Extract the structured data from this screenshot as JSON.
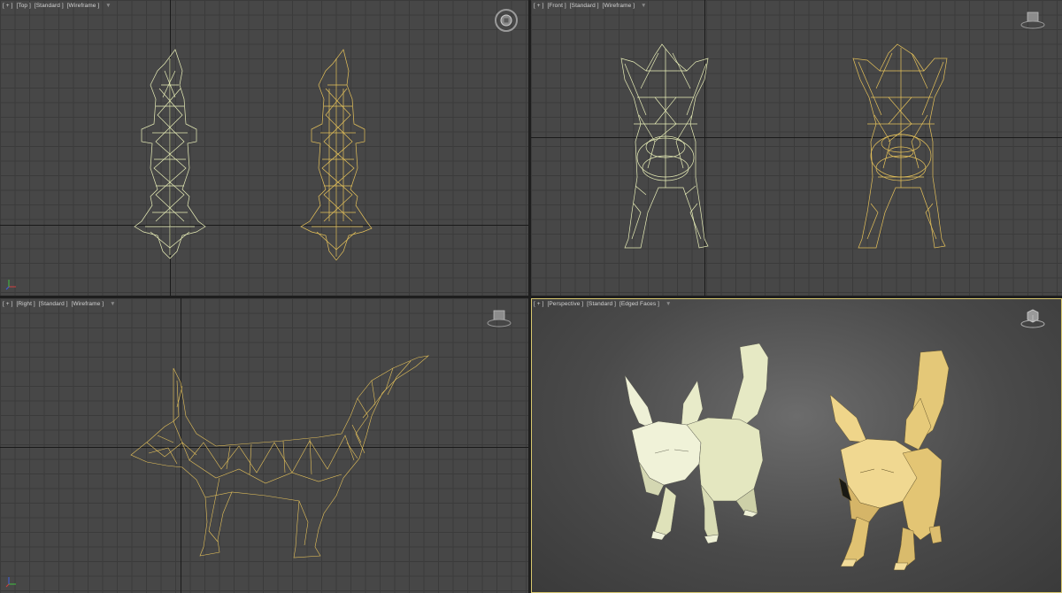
{
  "viewports": {
    "top": {
      "menu": "[ + ]",
      "view": "[Top ]",
      "shading_mode": "[Standard ]",
      "render_mode": "[Wireframe ]"
    },
    "front": {
      "menu": "[ + ]",
      "view": "[Front ]",
      "shading_mode": "[Standard ]",
      "render_mode": "[Wireframe ]"
    },
    "right": {
      "menu": "[ + ]",
      "view": "[Right ]",
      "shading_mode": "[Standard ]",
      "render_mode": "[Wireframe ]"
    },
    "persp": {
      "menu": "[ + ]",
      "view": "[Perspective ]",
      "shading_mode": "[Standard ]",
      "render_mode": "[Edged Faces ]"
    }
  },
  "icons": {
    "filter": "filter-funnel-icon",
    "steering_wheel": "steering-wheel-icon",
    "viewcube": "viewcube-icon",
    "axis_triad": "axis-triad-icon"
  },
  "colors": {
    "wire_pale": "#e9efb8",
    "wire_gold": "#e6c25a",
    "solid_pale": "#e8ebc9",
    "solid_gold": "#e9cd7c",
    "active_border": "#d8c870"
  }
}
